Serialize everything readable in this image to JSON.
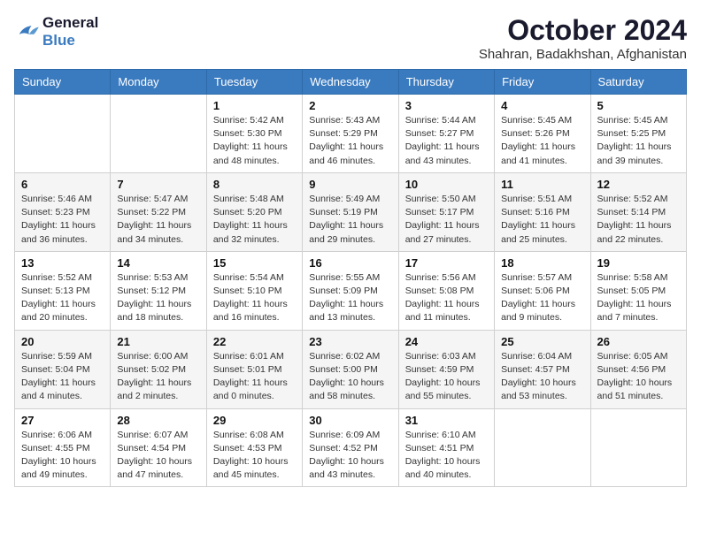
{
  "logo": {
    "text_general": "General",
    "text_blue": "Blue"
  },
  "title": "October 2024",
  "location": "Shahran, Badakhshan, Afghanistan",
  "days_of_week": [
    "Sunday",
    "Monday",
    "Tuesday",
    "Wednesday",
    "Thursday",
    "Friday",
    "Saturday"
  ],
  "weeks": [
    [
      {
        "day": null
      },
      {
        "day": null
      },
      {
        "day": "1",
        "sunrise": "5:42 AM",
        "sunset": "5:30 PM",
        "daylight": "11 hours and 48 minutes."
      },
      {
        "day": "2",
        "sunrise": "5:43 AM",
        "sunset": "5:29 PM",
        "daylight": "11 hours and 46 minutes."
      },
      {
        "day": "3",
        "sunrise": "5:44 AM",
        "sunset": "5:27 PM",
        "daylight": "11 hours and 43 minutes."
      },
      {
        "day": "4",
        "sunrise": "5:45 AM",
        "sunset": "5:26 PM",
        "daylight": "11 hours and 41 minutes."
      },
      {
        "day": "5",
        "sunrise": "5:45 AM",
        "sunset": "5:25 PM",
        "daylight": "11 hours and 39 minutes."
      }
    ],
    [
      {
        "day": "6",
        "sunrise": "5:46 AM",
        "sunset": "5:23 PM",
        "daylight": "11 hours and 36 minutes."
      },
      {
        "day": "7",
        "sunrise": "5:47 AM",
        "sunset": "5:22 PM",
        "daylight": "11 hours and 34 minutes."
      },
      {
        "day": "8",
        "sunrise": "5:48 AM",
        "sunset": "5:20 PM",
        "daylight": "11 hours and 32 minutes."
      },
      {
        "day": "9",
        "sunrise": "5:49 AM",
        "sunset": "5:19 PM",
        "daylight": "11 hours and 29 minutes."
      },
      {
        "day": "10",
        "sunrise": "5:50 AM",
        "sunset": "5:17 PM",
        "daylight": "11 hours and 27 minutes."
      },
      {
        "day": "11",
        "sunrise": "5:51 AM",
        "sunset": "5:16 PM",
        "daylight": "11 hours and 25 minutes."
      },
      {
        "day": "12",
        "sunrise": "5:52 AM",
        "sunset": "5:14 PM",
        "daylight": "11 hours and 22 minutes."
      }
    ],
    [
      {
        "day": "13",
        "sunrise": "5:52 AM",
        "sunset": "5:13 PM",
        "daylight": "11 hours and 20 minutes."
      },
      {
        "day": "14",
        "sunrise": "5:53 AM",
        "sunset": "5:12 PM",
        "daylight": "11 hours and 18 minutes."
      },
      {
        "day": "15",
        "sunrise": "5:54 AM",
        "sunset": "5:10 PM",
        "daylight": "11 hours and 16 minutes."
      },
      {
        "day": "16",
        "sunrise": "5:55 AM",
        "sunset": "5:09 PM",
        "daylight": "11 hours and 13 minutes."
      },
      {
        "day": "17",
        "sunrise": "5:56 AM",
        "sunset": "5:08 PM",
        "daylight": "11 hours and 11 minutes."
      },
      {
        "day": "18",
        "sunrise": "5:57 AM",
        "sunset": "5:06 PM",
        "daylight": "11 hours and 9 minutes."
      },
      {
        "day": "19",
        "sunrise": "5:58 AM",
        "sunset": "5:05 PM",
        "daylight": "11 hours and 7 minutes."
      }
    ],
    [
      {
        "day": "20",
        "sunrise": "5:59 AM",
        "sunset": "5:04 PM",
        "daylight": "11 hours and 4 minutes."
      },
      {
        "day": "21",
        "sunrise": "6:00 AM",
        "sunset": "5:02 PM",
        "daylight": "11 hours and 2 minutes."
      },
      {
        "day": "22",
        "sunrise": "6:01 AM",
        "sunset": "5:01 PM",
        "daylight": "11 hours and 0 minutes."
      },
      {
        "day": "23",
        "sunrise": "6:02 AM",
        "sunset": "5:00 PM",
        "daylight": "10 hours and 58 minutes."
      },
      {
        "day": "24",
        "sunrise": "6:03 AM",
        "sunset": "4:59 PM",
        "daylight": "10 hours and 55 minutes."
      },
      {
        "day": "25",
        "sunrise": "6:04 AM",
        "sunset": "4:57 PM",
        "daylight": "10 hours and 53 minutes."
      },
      {
        "day": "26",
        "sunrise": "6:05 AM",
        "sunset": "4:56 PM",
        "daylight": "10 hours and 51 minutes."
      }
    ],
    [
      {
        "day": "27",
        "sunrise": "6:06 AM",
        "sunset": "4:55 PM",
        "daylight": "10 hours and 49 minutes."
      },
      {
        "day": "28",
        "sunrise": "6:07 AM",
        "sunset": "4:54 PM",
        "daylight": "10 hours and 47 minutes."
      },
      {
        "day": "29",
        "sunrise": "6:08 AM",
        "sunset": "4:53 PM",
        "daylight": "10 hours and 45 minutes."
      },
      {
        "day": "30",
        "sunrise": "6:09 AM",
        "sunset": "4:52 PM",
        "daylight": "10 hours and 43 minutes."
      },
      {
        "day": "31",
        "sunrise": "6:10 AM",
        "sunset": "4:51 PM",
        "daylight": "10 hours and 40 minutes."
      },
      {
        "day": null
      },
      {
        "day": null
      }
    ]
  ],
  "labels": {
    "sunrise": "Sunrise:",
    "sunset": "Sunset:",
    "daylight": "Daylight:"
  }
}
